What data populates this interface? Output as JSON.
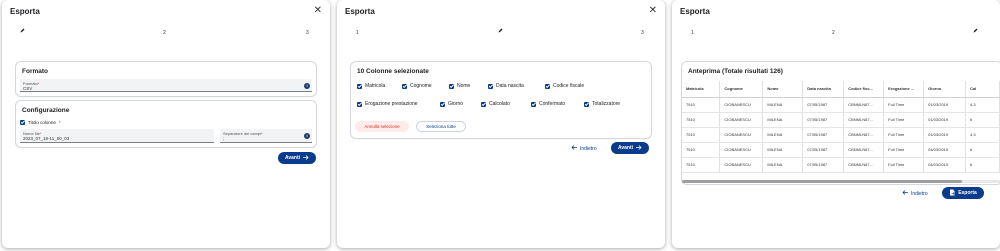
{
  "dialog1": {
    "title": "Esporta",
    "steps": [
      "2",
      "3"
    ],
    "formato": {
      "section_title": "Formato",
      "label": "Formato",
      "value": "CSV"
    },
    "configurazione": {
      "section_title": "Configurazione",
      "titolo_colonne": "Titolo colonne",
      "nome_file_label": "Nome file",
      "nome_file_value": "2023_07_18-11_00_03",
      "separatore_label": "Separatore dei campi",
      "separatore_value": ";"
    },
    "next_button": "Avanti",
    "required_mark": "*",
    "info_icon": "i"
  },
  "dialog2": {
    "title": "Esporta",
    "steps": [
      "1",
      "3"
    ],
    "columns_title": "10 Colonne selezionate",
    "columns": [
      "Matricola",
      "Cognome",
      "Nome",
      "Data nascita",
      "Codice fiscale",
      "Erogazione prestazione",
      "Giorno",
      "Calcolato",
      "Confermato",
      "Totalizzatore"
    ],
    "deselect_all": "Annulla selezione",
    "select_all": "Seleziona tutte",
    "back_button": "Indietro",
    "next_button": "Avanti"
  },
  "dialog3": {
    "title": "Esporta",
    "steps": [
      "1",
      "2"
    ],
    "preview_title": "Anteprima (Totale risultati 126)",
    "table": {
      "headers": [
        "Matricola",
        "Cognome",
        "Nome",
        "Data nascita",
        "Codice fisc...",
        "Erogazione ...",
        "Giorno",
        "Cal"
      ],
      "rows": [
        [
          "7510",
          "CIOBANESCU",
          "MILENA",
          "07/05/1987",
          "CBNMLN87...",
          "Full Time",
          "01/03/2019",
          "4,3"
        ],
        [
          "7510",
          "CIOBANESCU",
          "MILENA",
          "07/05/1987",
          "CBNMLN87...",
          "Full Time",
          "01/03/2019",
          "6"
        ],
        [
          "7510",
          "CIOBANESCU",
          "MILENA",
          "07/05/1987",
          "CBNMLN87...",
          "Full Time",
          "01/03/2019",
          "4,3"
        ],
        [
          "7510",
          "CIOBANESCU",
          "MILENA",
          "07/05/1987",
          "CBNMLN87...",
          "Full Time",
          "04/03/2019",
          "6"
        ],
        [
          "7510",
          "CIOBANESCU",
          "MILENA",
          "07/05/1987",
          "CBNMLN87...",
          "Full Time",
          "04/03/2019",
          "6"
        ]
      ]
    },
    "back_button": "Indietro",
    "export_button": "Esporta"
  },
  "icons": {
    "close": "close-icon",
    "pencil": "pencil-icon",
    "arrow_right": "arrow-right-icon",
    "arrow_left": "arrow-left-icon",
    "file_export": "file-export-icon",
    "checkbox": "checkbox-checked-icon",
    "info": "info-icon"
  },
  "colors": {
    "primary": "#0b3b8c",
    "danger": "#d93025",
    "field_bg": "#f1f3f4"
  }
}
